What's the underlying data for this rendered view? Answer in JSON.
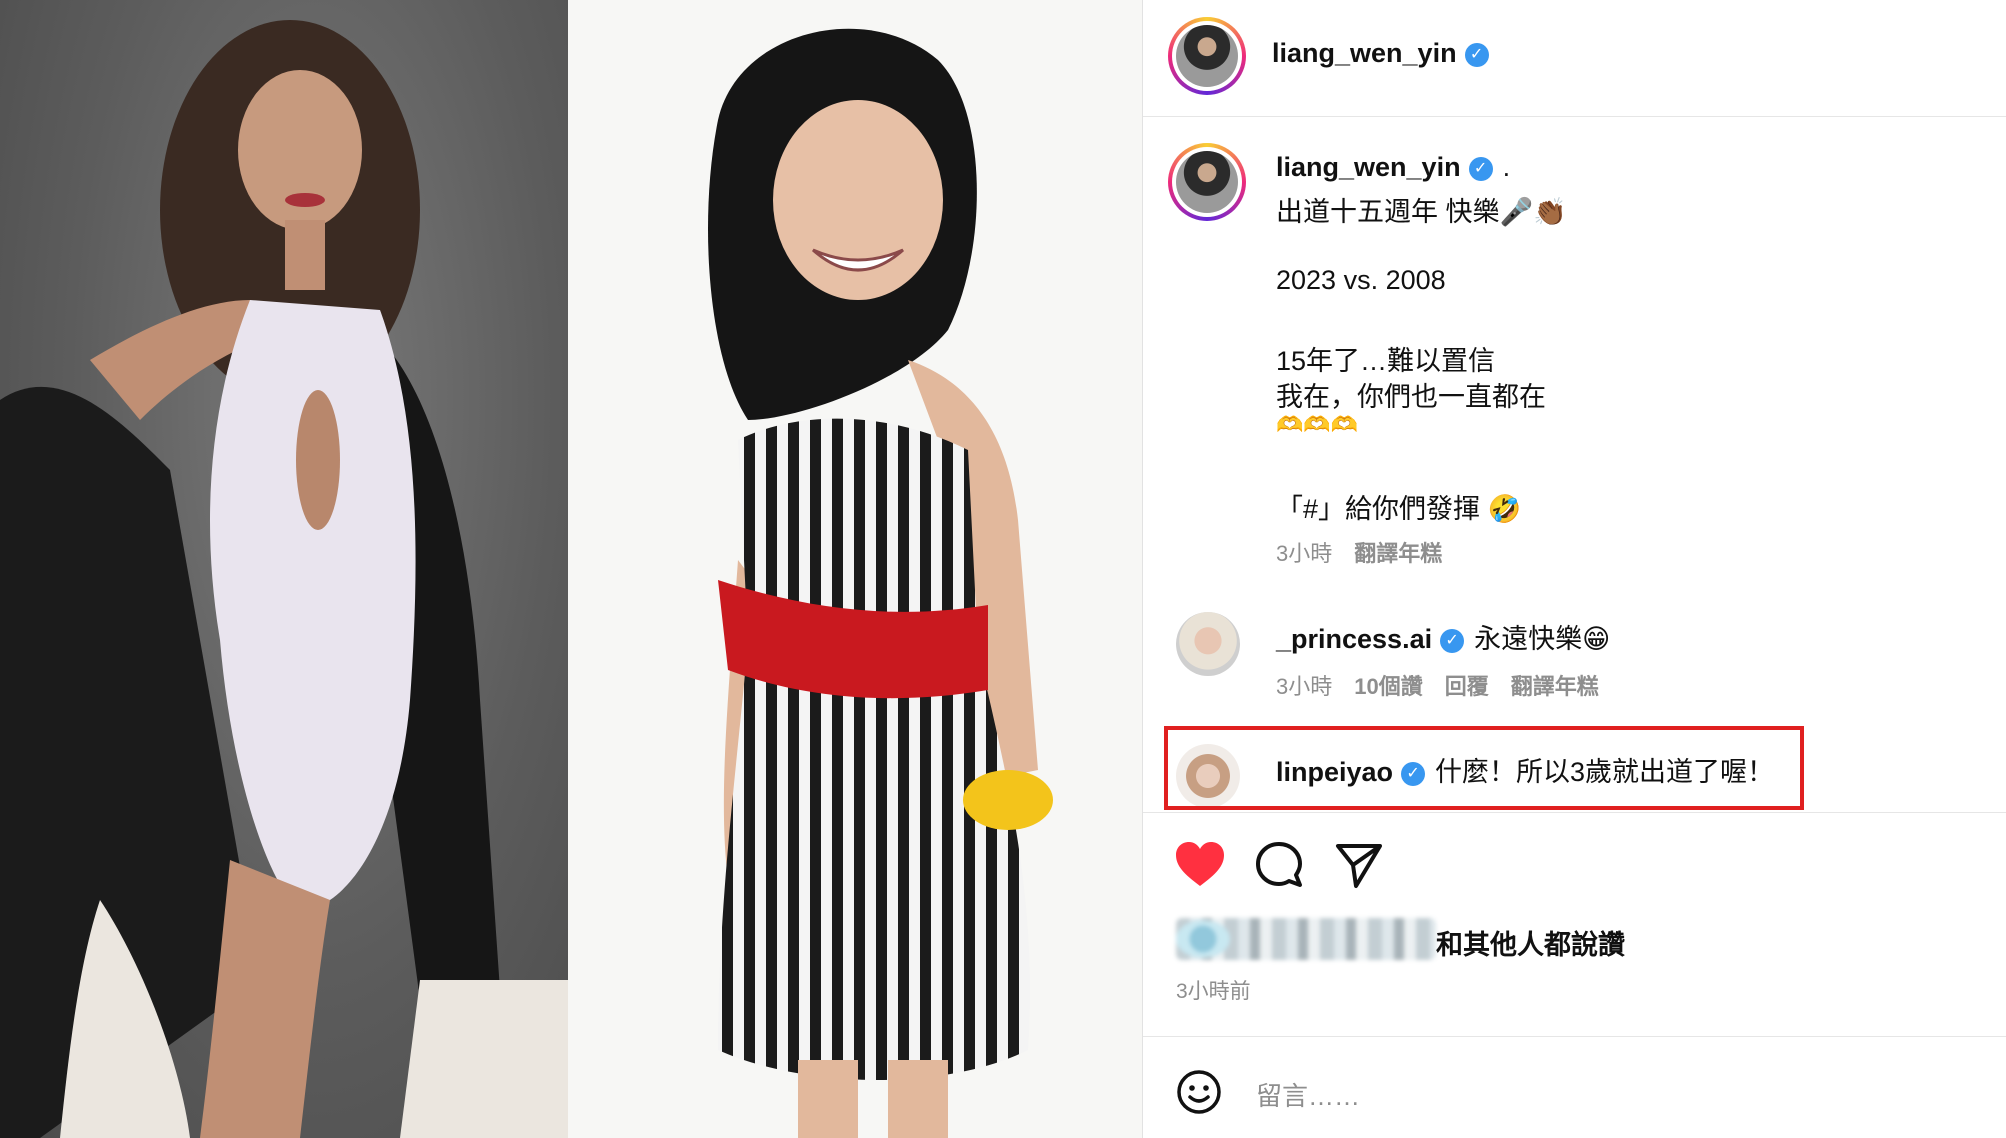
{
  "header": {
    "username": "liang_wen_yin"
  },
  "caption": {
    "username": "liang_wen_yin",
    "trailing": ".",
    "lines": [
      "出道十五週年 快樂🎤👏🏾",
      "2023 vs. 2008",
      "15年了…難以置信",
      "我在，你們也一直都在",
      "🫶🫶🫶",
      "「#」給你們發揮 🤣"
    ],
    "time": "3小時",
    "translate": "翻譯年糕"
  },
  "comments": [
    {
      "username": "_princess.ai",
      "text": "永遠快樂😁",
      "time": "3小時",
      "likes": "10個讚",
      "reply": "回覆",
      "translate": "翻譯年糕"
    },
    {
      "username": "linpeiyao",
      "text": "什麼！所以3歲就出道了喔！"
    }
  ],
  "likes": {
    "suffix": "和其他人都說讚",
    "time": "3小時前"
  },
  "comment_box": {
    "placeholder": "留言……"
  },
  "colors": {
    "like_red": "#ff3040",
    "verified_blue": "#3897f0",
    "highlight_red": "#e02020"
  },
  "icons": [
    "heart-icon",
    "comment-icon",
    "share-icon",
    "emoji-icon",
    "verified-icon"
  ]
}
